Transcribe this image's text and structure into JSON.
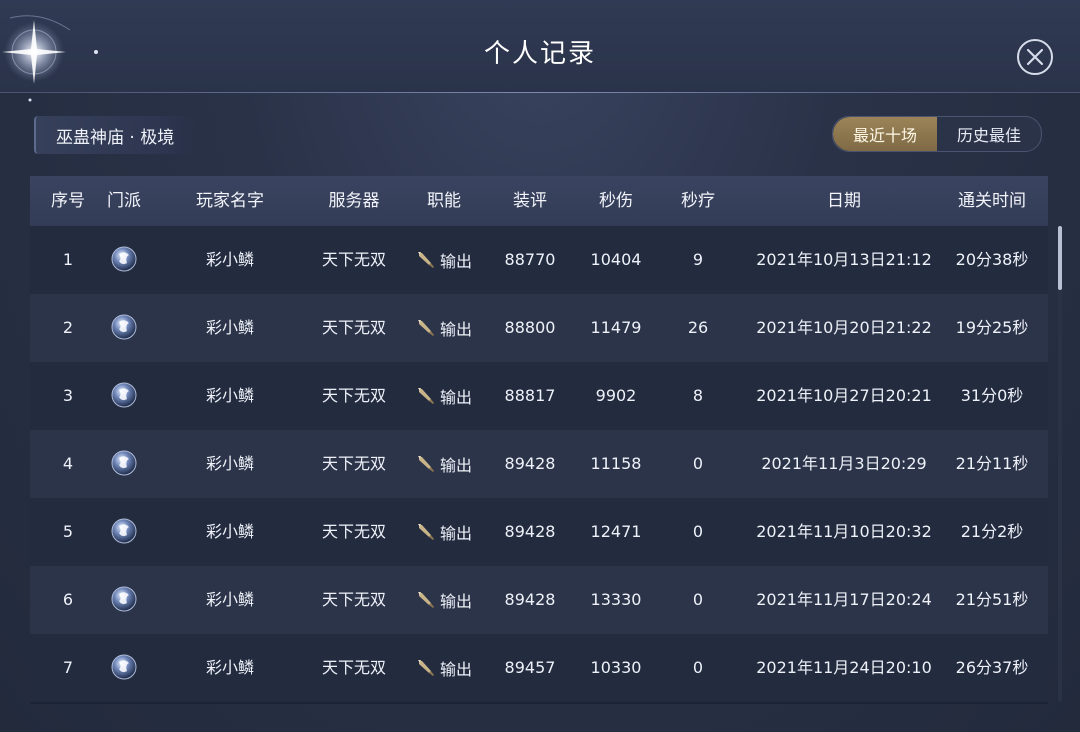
{
  "window": {
    "title": "个人记录"
  },
  "dungeon": {
    "name": "巫蛊神庙 · 极境"
  },
  "toggle": {
    "options": [
      "最近十场",
      "历史最佳"
    ],
    "selected": "最近十场"
  },
  "table": {
    "headers": [
      "序号",
      "门派",
      "玩家名字",
      "服务器",
      "职能",
      "装评",
      "秒伤",
      "秒疗",
      "日期",
      "通关时间"
    ],
    "rows": [
      {
        "index": "1",
        "sect_icon": "sect-emblem-icon",
        "player": "彩小鳞",
        "server": "天下无双",
        "role": "输出",
        "gear": "88770",
        "dps": "10404",
        "hps": "9",
        "date": "2021年10月13日21:12",
        "clear_time": "20分38秒"
      },
      {
        "index": "2",
        "sect_icon": "sect-emblem-icon",
        "player": "彩小鳞",
        "server": "天下无双",
        "role": "输出",
        "gear": "88800",
        "dps": "11479",
        "hps": "26",
        "date": "2021年10月20日21:22",
        "clear_time": "19分25秒"
      },
      {
        "index": "3",
        "sect_icon": "sect-emblem-icon",
        "player": "彩小鳞",
        "server": "天下无双",
        "role": "输出",
        "gear": "88817",
        "dps": "9902",
        "hps": "8",
        "date": "2021年10月27日20:21",
        "clear_time": "31分0秒"
      },
      {
        "index": "4",
        "sect_icon": "sect-emblem-icon",
        "player": "彩小鳞",
        "server": "天下无双",
        "role": "输出",
        "gear": "89428",
        "dps": "11158",
        "hps": "0",
        "date": "2021年11月3日20:29",
        "clear_time": "21分11秒"
      },
      {
        "index": "5",
        "sect_icon": "sect-emblem-icon",
        "player": "彩小鳞",
        "server": "天下无双",
        "role": "输出",
        "gear": "89428",
        "dps": "12471",
        "hps": "0",
        "date": "2021年11月10日20:32",
        "clear_time": "21分2秒"
      },
      {
        "index": "6",
        "sect_icon": "sect-emblem-icon",
        "player": "彩小鳞",
        "server": "天下无双",
        "role": "输出",
        "gear": "89428",
        "dps": "13330",
        "hps": "0",
        "date": "2021年11月17日20:24",
        "clear_time": "21分51秒"
      },
      {
        "index": "7",
        "sect_icon": "sect-emblem-icon",
        "player": "彩小鳞",
        "server": "天下无双",
        "role": "输出",
        "gear": "89457",
        "dps": "10330",
        "hps": "0",
        "date": "2021年11月24日20:10",
        "clear_time": "26分37秒"
      }
    ]
  },
  "colors": {
    "accent_gold": "#9c8458",
    "background": "#2a3248",
    "row_odd": "#232b3f",
    "row_even": "#2c3449",
    "text": "#eef1f8"
  },
  "icons": {
    "close": "close-icon",
    "role_dps": "dagger-icon",
    "sect": "sect-emblem-icon",
    "decor": "star-icon"
  }
}
